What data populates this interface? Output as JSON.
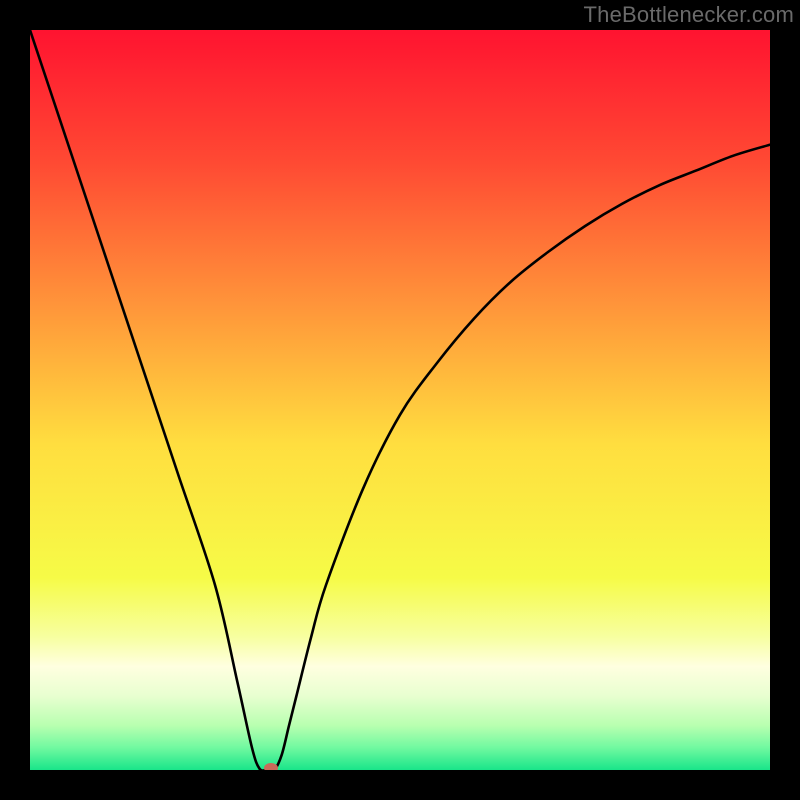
{
  "attribution": "TheBottlenecker.com",
  "chart_data": {
    "type": "line",
    "title": "",
    "xlabel": "",
    "ylabel": "",
    "xlim": [
      0,
      100
    ],
    "ylim": [
      0,
      100
    ],
    "series": [
      {
        "name": "bottleneck-curve",
        "x": [
          0,
          5,
          10,
          15,
          20,
          25,
          28,
          30,
          31,
          32,
          33,
          34,
          35,
          36,
          38,
          40,
          45,
          50,
          55,
          60,
          65,
          70,
          75,
          80,
          85,
          90,
          95,
          100
        ],
        "values": [
          100,
          85,
          70,
          55,
          40,
          25,
          12,
          3,
          0.2,
          0,
          0,
          2,
          6,
          10,
          18,
          25,
          38,
          48,
          55,
          61,
          66,
          70,
          73.5,
          76.5,
          79,
          81,
          83,
          84.5
        ]
      }
    ],
    "marker": {
      "x": 32.5,
      "y": 0
    },
    "gradient_stops": [
      {
        "offset": 0,
        "color": "#ff1330"
      },
      {
        "offset": 0.18,
        "color": "#ff4a33"
      },
      {
        "offset": 0.38,
        "color": "#ff983a"
      },
      {
        "offset": 0.56,
        "color": "#ffde3f"
      },
      {
        "offset": 0.74,
        "color": "#f6fb47"
      },
      {
        "offset": 0.82,
        "color": "#f7ffa0"
      },
      {
        "offset": 0.86,
        "color": "#ffffe0"
      },
      {
        "offset": 0.9,
        "color": "#e8ffd0"
      },
      {
        "offset": 0.94,
        "color": "#b8ffb0"
      },
      {
        "offset": 0.97,
        "color": "#70f9a0"
      },
      {
        "offset": 1.0,
        "color": "#19e58a"
      }
    ]
  }
}
